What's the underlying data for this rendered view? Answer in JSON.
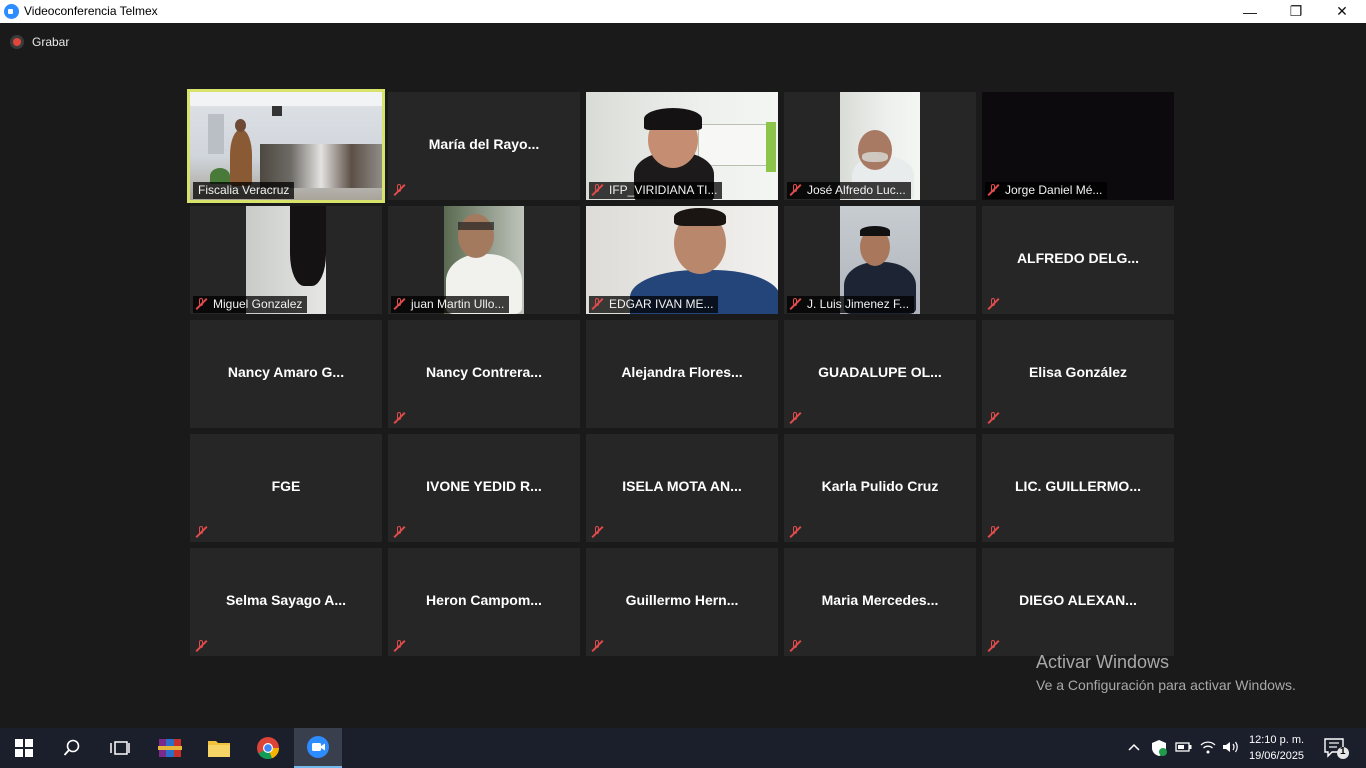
{
  "window": {
    "title": "Videoconferencia Telmex",
    "minimize_glyph": "—",
    "restore_glyph": "❐",
    "close_glyph": "✕"
  },
  "toolbar": {
    "record_label": "Grabar"
  },
  "participants": [
    {
      "name": "Fiscalia Veracruz",
      "video": true,
      "muted": false,
      "active_speaker": true
    },
    {
      "name": "María  del  Rayo...",
      "video": false,
      "muted": true
    },
    {
      "name": "IFP_VIRIDIANA TI...",
      "video": true,
      "muted": true
    },
    {
      "name": "José Alfredo Luc...",
      "video": true,
      "muted": true
    },
    {
      "name": "Jorge Daniel Mé...",
      "video": true,
      "muted": true
    },
    {
      "name": "Miguel Gonzalez",
      "video": true,
      "muted": true
    },
    {
      "name": "juan Martin Ullo...",
      "video": true,
      "muted": true
    },
    {
      "name": "EDGAR IVAN ME...",
      "video": true,
      "muted": true
    },
    {
      "name": "J. Luis Jimenez F...",
      "video": true,
      "muted": true
    },
    {
      "name": "ALFREDO DELG...",
      "video": false,
      "muted": true
    },
    {
      "name": "Nancy Amaro G...",
      "video": false,
      "muted": false
    },
    {
      "name": "Nancy  Contrera...",
      "video": false,
      "muted": true
    },
    {
      "name": "Alejandra  Flores...",
      "video": false,
      "muted": false
    },
    {
      "name": "GUADALUPE OL...",
      "video": false,
      "muted": true
    },
    {
      "name": "Elisa González",
      "video": false,
      "muted": true
    },
    {
      "name": "FGE",
      "video": false,
      "muted": true
    },
    {
      "name": "IVONE YEDID R...",
      "video": false,
      "muted": true
    },
    {
      "name": "ISELA MOTA AN...",
      "video": false,
      "muted": true
    },
    {
      "name": "Karla Pulido Cruz",
      "video": false,
      "muted": true
    },
    {
      "name": "LIC. GUILLERMO...",
      "video": false,
      "muted": true
    },
    {
      "name": "Selma Sayago A...",
      "video": false,
      "muted": true
    },
    {
      "name": "Heron  Campom...",
      "video": false,
      "muted": true
    },
    {
      "name": "Guillermo  Hern...",
      "video": false,
      "muted": true
    },
    {
      "name": "Maria  Mercedes...",
      "video": false,
      "muted": true
    },
    {
      "name": "DIEGO ALEXAN...",
      "video": false,
      "muted": true
    }
  ],
  "watermark": {
    "line1": "Activar Windows",
    "line2": "Ve a Configuración para activar Windows."
  },
  "taskbar": {
    "time": "12:10 p. m.",
    "date": "19/06/2025",
    "notification_count": "1",
    "icons": [
      "windows-start-icon",
      "search-icon",
      "task-view-icon",
      "winrar-icon",
      "file-explorer-icon",
      "chrome-icon",
      "telmex-video-icon"
    ],
    "tray_icons": [
      "chevron-up-icon",
      "security-shield-icon",
      "battery-icon",
      "wifi-icon",
      "speaker-icon",
      "notification-icon"
    ]
  },
  "colors": {
    "active_speaker_border": "#d7e36b",
    "mute_icon": "#e04b4b",
    "tile_background": "#262626",
    "accent": "#2d8cff"
  }
}
